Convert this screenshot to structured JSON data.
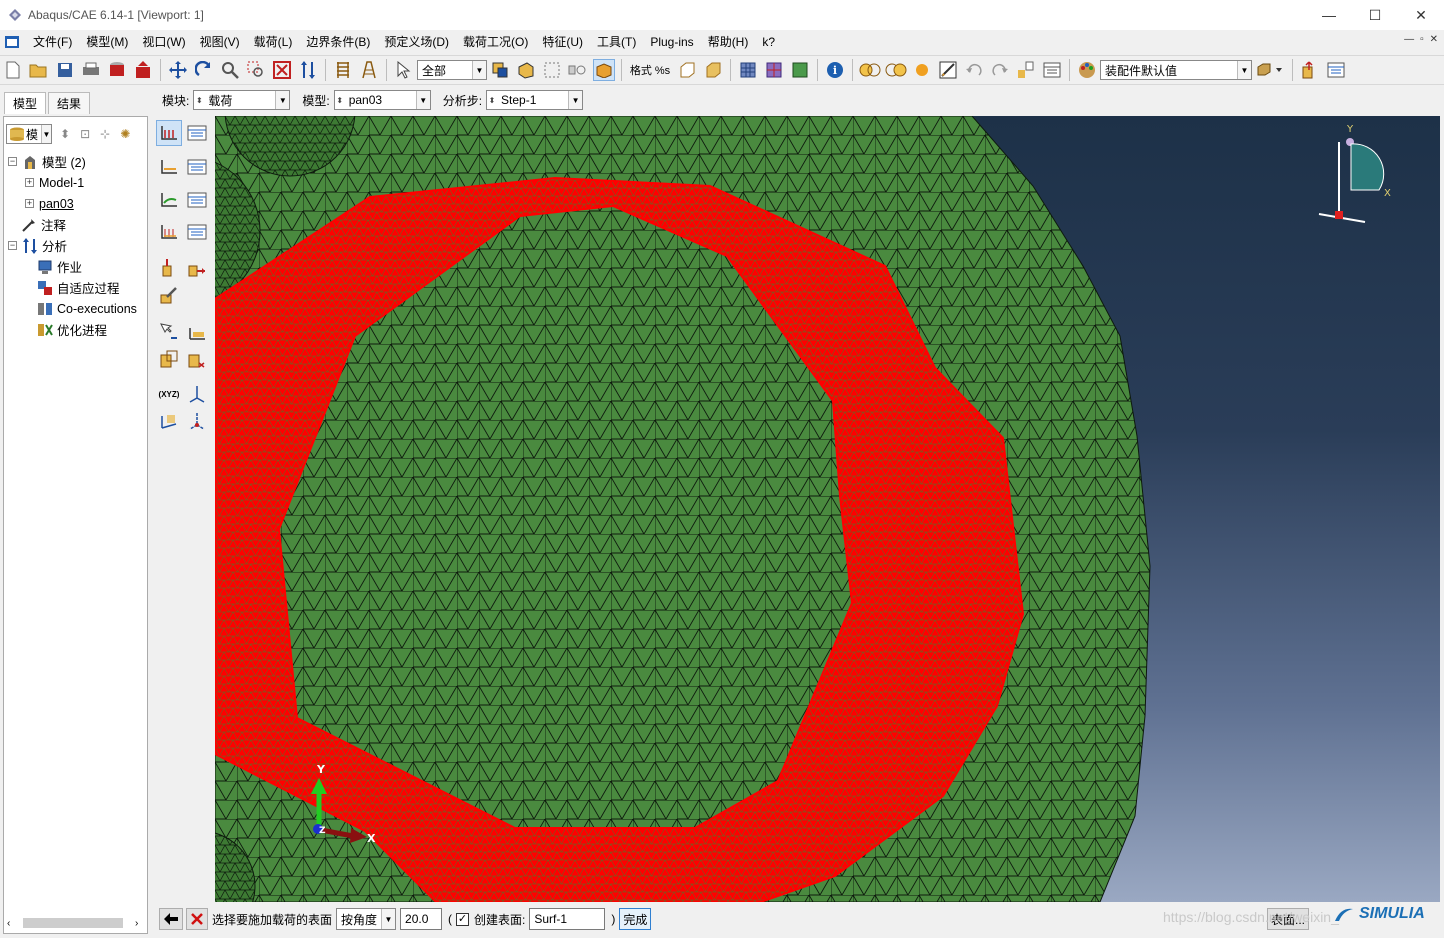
{
  "window": {
    "title": "Abaqus/CAE 6.14-1 [Viewport: 1]",
    "buttons": [
      "—",
      "☐",
      "✕"
    ]
  },
  "menubar": {
    "items": [
      "文件(F)",
      "模型(M)",
      "视口(W)",
      "视图(V)",
      "载荷(L)",
      "边界条件(B)",
      "预定义场(D)",
      "载荷工况(O)",
      "特征(U)",
      "工具(T)",
      "Plug-ins",
      "帮助(H)",
      "k?"
    ],
    "mdi_buttons": [
      "—",
      "▫",
      "✕"
    ]
  },
  "toolbar": {
    "selection_filter": "全部",
    "format_label": "格式 %s",
    "render_style": "装配件默认值"
  },
  "context": {
    "module_label": "模块:",
    "module_value": "载荷",
    "model_label": "模型:",
    "model_value": "pan03",
    "step_label": "分析步:",
    "step_value": "Step-1"
  },
  "left_panel": {
    "tabs": [
      "模型",
      "结果"
    ],
    "tree_selector": "模",
    "tree": [
      {
        "label": "模型 (2)",
        "level": 0,
        "expander": "−",
        "icon": "models-icon"
      },
      {
        "label": "Model-1",
        "level": 1,
        "expander": "+",
        "icon": ""
      },
      {
        "label": "pan03",
        "level": 1,
        "expander": "+",
        "icon": ""
      },
      {
        "label": "注释",
        "level": 0,
        "expander": "",
        "icon": "annotation-icon"
      },
      {
        "label": "分析",
        "level": 0,
        "expander": "−",
        "icon": "analysis-icon"
      },
      {
        "label": "作业",
        "level": 1,
        "expander": "",
        "icon": "job-icon"
      },
      {
        "label": "自适应过程",
        "level": 1,
        "expander": "",
        "icon": "adaptivity-icon"
      },
      {
        "label": "Co-executions",
        "level": 1,
        "expander": "",
        "icon": "coexecution-icon"
      },
      {
        "label": "优化进程",
        "level": 1,
        "expander": "",
        "icon": "optimization-icon"
      }
    ]
  },
  "viewport": {
    "triad": {
      "y": "Y",
      "x": "X"
    },
    "local_csys": {
      "y": "Y",
      "x": "X",
      "z": "Z"
    },
    "colors": {
      "mesh": "#4a8a3f",
      "selected": "#ff0000",
      "edges": "#0d1a0d"
    }
  },
  "prompt": {
    "instruction": "选择要施加载荷的表面",
    "method": "按角度",
    "angle": "20.0",
    "paren_open": "(",
    "create_surface_label": "创建表面:",
    "create_surface_checked": "✓",
    "surface_name": "Surf-1",
    "paren_close": ")",
    "done": "完成",
    "surfaces_button": "表面..."
  },
  "footer": {
    "watermark": "https://blog.csdn.net/weixin_",
    "brand": "SIMULIA"
  }
}
